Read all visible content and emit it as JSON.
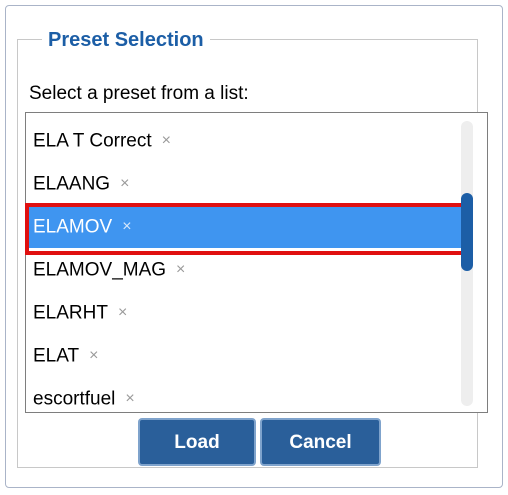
{
  "dialog": {
    "group_title": "Preset Selection",
    "prompt": "Select a preset from a list:",
    "presets": [
      {
        "label": "ELA T Correct",
        "remove_icon": "close-icon"
      },
      {
        "label": "ELAANG",
        "remove_icon": "close-icon"
      },
      {
        "label": "ELAMOV",
        "remove_icon": "close-icon",
        "selected": true
      },
      {
        "label": "ELAMOV_MAG",
        "remove_icon": "close-icon"
      },
      {
        "label": "ELARHT",
        "remove_icon": "close-icon"
      },
      {
        "label": "ELAT",
        "remove_icon": "close-icon"
      },
      {
        "label": "escortfuel",
        "remove_icon": "close-icon"
      }
    ],
    "selected_index": 2,
    "remove_glyph": "×",
    "scroll_position": 0.35,
    "buttons": {
      "load_label": "Load",
      "cancel_label": "Cancel"
    }
  },
  "colors": {
    "accent": "#1c5ea6",
    "selection": "#3f95f0",
    "button": "#2a5f9a",
    "highlight_frame": "#e01010"
  }
}
